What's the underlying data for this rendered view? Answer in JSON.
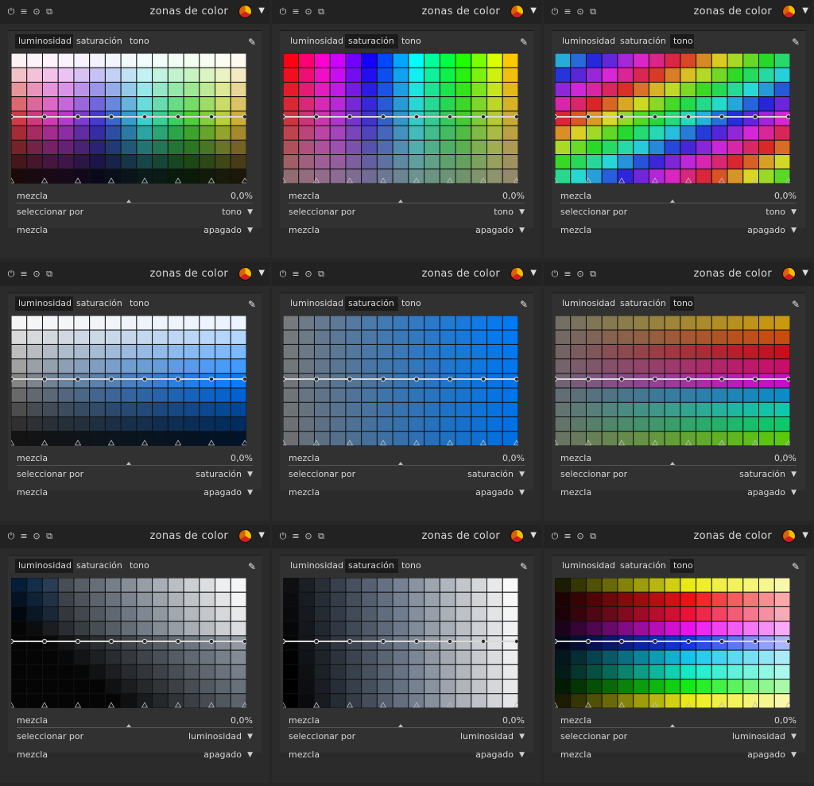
{
  "panels": [
    {
      "title": "zonas de color",
      "tabs": [
        "luminosidad",
        "saturación",
        "tono"
      ],
      "active_tab": 0,
      "variant": "lum",
      "blend_label": "mezcla",
      "blend_value": "0,0%",
      "select_label": "seleccionar por",
      "select_value": "tono",
      "mix_label": "mezcla",
      "mix_value": "apagado"
    },
    {
      "title": "zonas de color",
      "tabs": [
        "luminosidad",
        "saturación",
        "tono"
      ],
      "active_tab": 1,
      "variant": "sat",
      "blend_label": "mezcla",
      "blend_value": "0,0%",
      "select_label": "seleccionar por",
      "select_value": "tono",
      "mix_label": "mezcla",
      "mix_value": "apagado"
    },
    {
      "title": "zonas de color",
      "tabs": [
        "luminosidad",
        "saturación",
        "tono"
      ],
      "active_tab": 2,
      "variant": "hue",
      "blend_label": "mezcla",
      "blend_value": "0,0%",
      "select_label": "seleccionar por",
      "select_value": "tono",
      "mix_label": "mezcla",
      "mix_value": "apagado"
    },
    {
      "title": "zonas de color",
      "tabs": [
        "luminosidad",
        "saturación",
        "tono"
      ],
      "active_tab": 0,
      "variant": "lum_blue",
      "blend_label": "mezcla",
      "blend_value": "0,0%",
      "select_label": "seleccionar por",
      "select_value": "saturación",
      "mix_label": "mezcla",
      "mix_value": "apagado"
    },
    {
      "title": "zonas de color",
      "tabs": [
        "luminosidad",
        "saturación",
        "tono"
      ],
      "active_tab": 1,
      "variant": "sat_blue",
      "blend_label": "mezcla",
      "blend_value": "0,0%",
      "select_label": "seleccionar por",
      "select_value": "saturación",
      "mix_label": "mezcla",
      "mix_value": "apagado"
    },
    {
      "title": "zonas de color",
      "tabs": [
        "luminosidad",
        "saturación",
        "tono"
      ],
      "active_tab": 2,
      "variant": "hue_sat",
      "blend_label": "mezcla",
      "blend_value": "0,0%",
      "select_label": "seleccionar por",
      "select_value": "saturación",
      "mix_label": "mezcla",
      "mix_value": "apagado"
    },
    {
      "title": "zonas de color",
      "tabs": [
        "luminosidad",
        "saturación",
        "tono"
      ],
      "active_tab": 0,
      "variant": "lum_lum",
      "blend_label": "mezcla",
      "blend_value": "0,0%",
      "select_label": "seleccionar por",
      "select_value": "luminosidad",
      "mix_label": "mezcla",
      "mix_value": "apagado"
    },
    {
      "title": "zonas de color",
      "tabs": [
        "luminosidad",
        "saturación",
        "tono"
      ],
      "active_tab": 1,
      "variant": "sat_lum",
      "blend_label": "mezcla",
      "blend_value": "0,0%",
      "select_label": "seleccionar por",
      "select_value": "luminosidad",
      "mix_label": "mezcla",
      "mix_value": "apagado"
    },
    {
      "title": "zonas de color",
      "tabs": [
        "luminosidad",
        "saturación",
        "tono"
      ],
      "active_tab": 2,
      "variant": "hue_lum",
      "blend_label": "mezcla",
      "blend_value": "0,0%",
      "select_label": "seleccionar por",
      "select_value": "luminosidad",
      "mix_label": "mezcla",
      "mix_value": "apagado"
    }
  ],
  "header_icons": [
    "power-icon",
    "presets-icon",
    "reset-icon",
    "copy-icon"
  ],
  "colors": {
    "panel_bg": "#2b2b2b",
    "header_bg": "#222222",
    "curve": "#cfcfcf"
  }
}
